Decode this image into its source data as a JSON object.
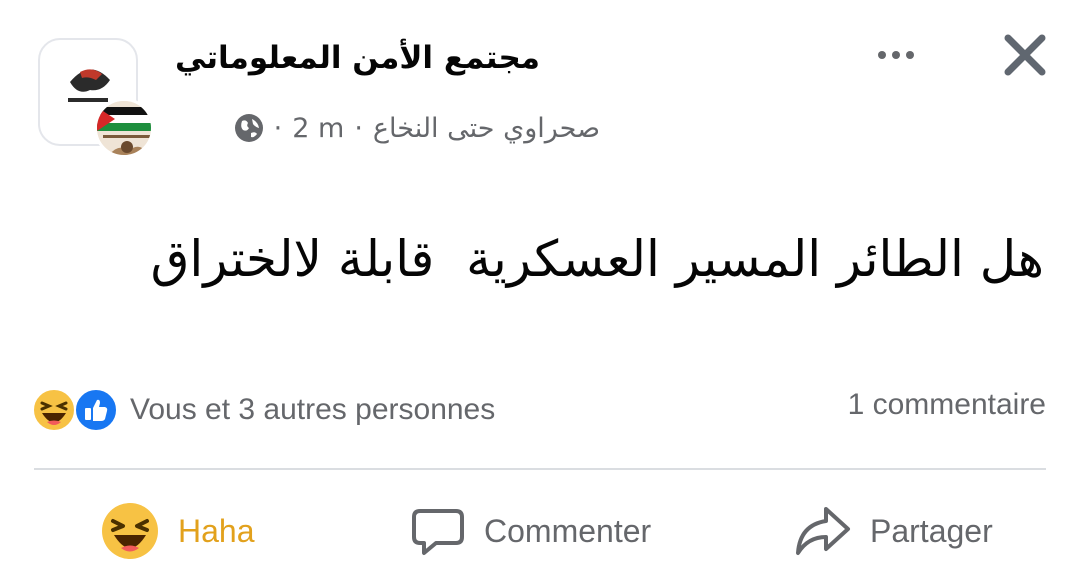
{
  "post": {
    "group_name": "مجتمع الأمن المعلوماتي",
    "author": "صحراوي حتى النخاع",
    "time": "2 m",
    "text": "هل الطائر المسير العسكرية  قابلة لالختراق"
  },
  "reactions": {
    "summary": "Vous et 3 autres personnes",
    "icons": [
      "haha-emoji-icon",
      "like-icon"
    ],
    "comments": "1 commentaire"
  },
  "actions": {
    "haha": "Haha",
    "comment": "Commenter",
    "share": "Partager"
  },
  "colors": {
    "haha_active": "#e2a11c",
    "secondary_text": "#65676b",
    "like_blue": "#1877f2",
    "divider": "#dadde1"
  }
}
